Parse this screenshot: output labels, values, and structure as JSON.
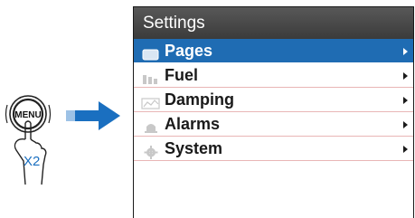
{
  "illustration": {
    "button_text": "MENU",
    "press_count": "X2"
  },
  "settings": {
    "title": "Settings",
    "items": [
      {
        "label": "Pages",
        "icon": "pages-icon",
        "selected": true
      },
      {
        "label": "Fuel",
        "icon": "fuel-icon",
        "selected": false
      },
      {
        "label": "Damping",
        "icon": "damping-icon",
        "selected": false
      },
      {
        "label": "Alarms",
        "icon": "alarm-bell-icon",
        "selected": false
      },
      {
        "label": "System",
        "icon": "system-gear-icon",
        "selected": false
      }
    ]
  },
  "colors": {
    "accent": "#1f6cb3",
    "arrow": "#1a6fc0",
    "titlebar": "#474747",
    "divider": "#e9b6b6"
  }
}
